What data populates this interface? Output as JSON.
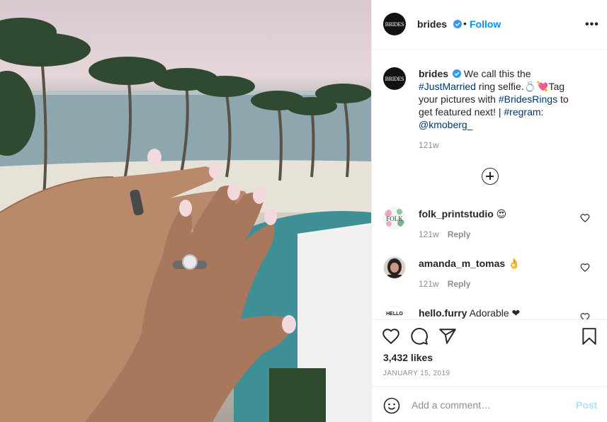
{
  "post": {
    "author": "brides",
    "avatar_text": "BRIDES",
    "follow_label": "Follow",
    "separator": "•",
    "more_label": "•••"
  },
  "caption": {
    "author": "brides",
    "part1": " We call this the ",
    "tag1": "#JustMarried",
    "part2": " ring selfie.💍💘Tag your pictures with ",
    "tag2": "#BridesRings",
    "part3": " to get featured next! | ",
    "tag3": "#regram",
    "part4": ": ",
    "mention": "@kmoberg_",
    "time": "121w"
  },
  "comments": [
    {
      "user": "folk_printstudio",
      "text": " 😍",
      "time": "121w",
      "reply": "Reply",
      "avatar_text": "FOLK"
    },
    {
      "user": "amanda_m_tomas",
      "text": " 👌",
      "time": "121w",
      "reply": "Reply",
      "avatar_text": ""
    },
    {
      "user": "hello.furry",
      "text": " Adorable ❤",
      "time": "",
      "reply": "",
      "avatar_text": "HELLO"
    }
  ],
  "footer": {
    "likes": "3,432 likes",
    "date": "JANUARY 15, 2019",
    "add_comment_placeholder": "Add a comment…",
    "post_label": "Post"
  },
  "icons": {
    "heart": "heart-icon",
    "comment": "comment-icon",
    "share": "share-icon",
    "save": "bookmark-icon",
    "emoji": "emoji-icon",
    "verified": "verified-badge-icon",
    "add": "plus-circle-icon"
  },
  "colors": {
    "link": "#0095f6",
    "hashtag": "#00376b",
    "muted": "#8e8e8e",
    "post_disabled": "#b2dffc"
  }
}
